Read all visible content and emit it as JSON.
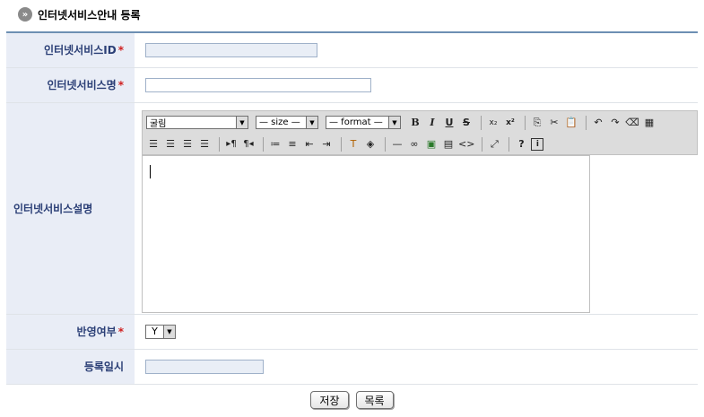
{
  "page": {
    "title": "인터넷서비스안내 등록",
    "title_icon": "circle-arrow-icon"
  },
  "form": {
    "service_id": {
      "label": "인터넷서비스ID",
      "required": "*",
      "value": ""
    },
    "service_name": {
      "label": "인터넷서비스명",
      "required": "*",
      "value": ""
    },
    "service_desc": {
      "label": "인터넷서비스설명"
    },
    "reflect": {
      "label": "반영여부",
      "required": "*",
      "selected": "Y"
    },
    "reg_date": {
      "label": "등록일시",
      "value": ""
    }
  },
  "editor": {
    "font_select": "굴림",
    "size_select": "— size —",
    "format_select": "— format —",
    "bold": "B",
    "italic": "I",
    "underline": "U",
    "strike": "S",
    "help": "?"
  },
  "buttons": {
    "save": "저장",
    "list": "목록"
  }
}
